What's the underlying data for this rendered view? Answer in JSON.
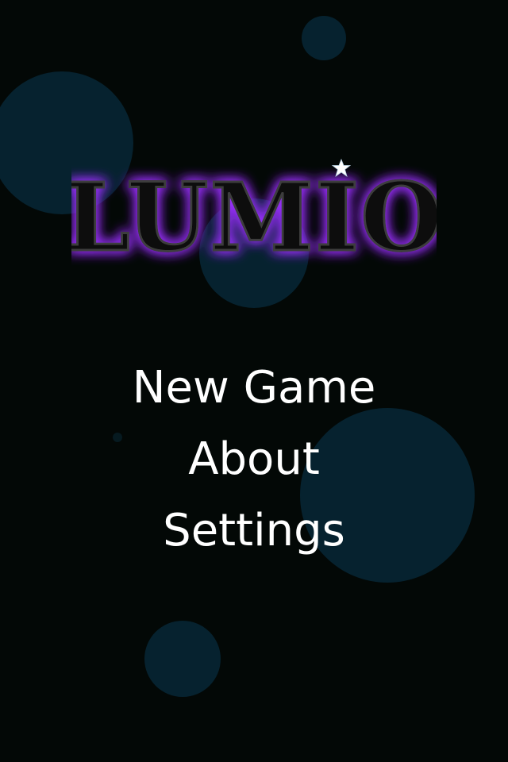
{
  "logo": {
    "text": "LUMIO",
    "glow_color": "#8a2be2",
    "fill_color": "#070707",
    "star_icon": "star-icon"
  },
  "menu": {
    "items": [
      {
        "label": "New Game"
      },
      {
        "label": "About"
      },
      {
        "label": "Settings"
      }
    ]
  },
  "colors": {
    "background": "#030806",
    "bubble": "#06222f",
    "menu_text": "#ffffff"
  }
}
